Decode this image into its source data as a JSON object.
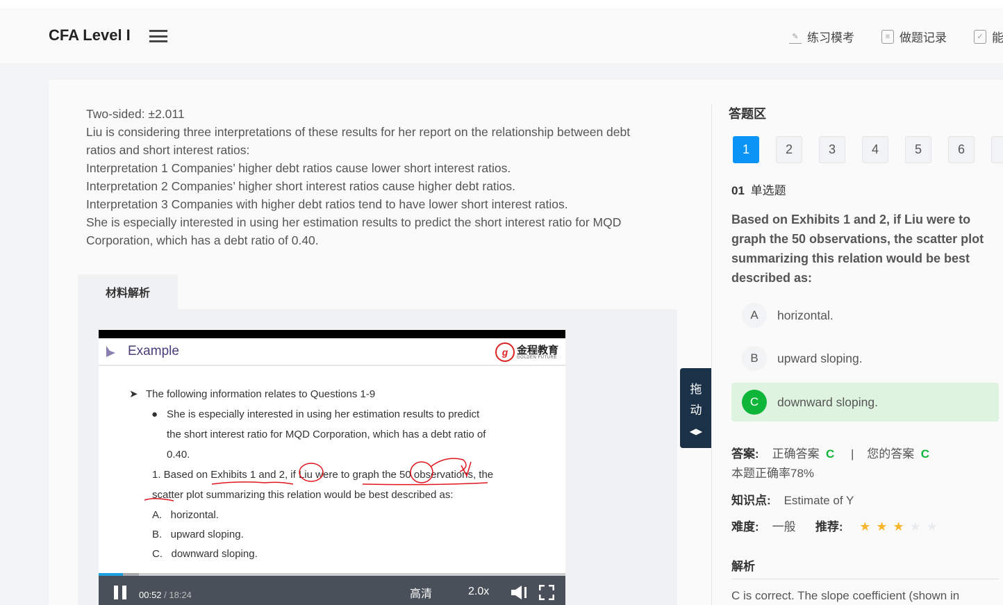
{
  "header": {
    "title": "CFA Level I",
    "nav": [
      {
        "label": "练习模考",
        "icon": "pencil-icon"
      },
      {
        "label": "做题记录",
        "icon": "clipboard-icon"
      },
      {
        "label": "能",
        "icon": "checkbox-icon"
      }
    ]
  },
  "passage": [
    "Two-sided: ±2.011",
    "Liu is considering three interpretations of these results for her report on the relationship between debt ratios and short interest ratios:",
    "Interpretation 1 Companies’ higher debt ratios cause lower short interest ratios.",
    "Interpretation 2 Companies’ higher short interest ratios cause higher debt ratios.",
    "Interpretation 3 Companies with higher debt ratios tend to have lower short interest ratios.",
    "She is especially interested in using her estimation results to predict the short interest ratio for MQD Corporation, which has a debt ratio of 0.40."
  ],
  "material_tab": "材料解析",
  "video": {
    "slide_title": "Example",
    "brand_cn": "金程教育",
    "brand_en": "GOLDEN FUTURE",
    "lines": {
      "intro": "The following information relates to Questions 1-9",
      "bullet1": "She is especially interested in using her estimation results to predict",
      "bullet2": "the short interest ratio for MQD Corporation, which has a debt ratio of",
      "bullet3": "0.40.",
      "q1": "1. Based on Exhibits 1 and 2, if Liu were to graph the 50 observations, the",
      "q2": "scatter plot summarizing this relation would be best described as:",
      "a": "A.   horizontal.",
      "b": "B.   upward sloping.",
      "c": "C.   downward sloping."
    },
    "current_time": "00:52",
    "total_time": " / 18:24",
    "quality": "高清",
    "speed": "2.0x",
    "progress_fraction": 0.052
  },
  "drag_handle": {
    "l1": "拖",
    "l2": "动"
  },
  "answer_area": {
    "title": "答题区",
    "numbers": [
      "1",
      "2",
      "3",
      "4",
      "5",
      "6"
    ],
    "active": "1",
    "qnum": "01",
    "qtype": "单选题",
    "question": "Based on Exhibits 1 and 2, if Liu were to graph the 50 observations, the scatter plot summarizing this relation would be best described as:",
    "options": [
      {
        "letter": "A",
        "text": "horizontal."
      },
      {
        "letter": "B",
        "text": "upward sloping."
      },
      {
        "letter": "C",
        "text": "downward sloping."
      }
    ],
    "answer_label": "答案:",
    "correct_label": "正确答案",
    "correct": "C",
    "sep": "|",
    "your_label": "您的答案",
    "yours": "C",
    "accuracy": "本题正确率78%",
    "kp_label": "知识点:",
    "kp": "Estimate of Y",
    "difficulty_label": "难度:",
    "difficulty": "一般",
    "recommend_label": "推荐:",
    "rating": 3,
    "rating_max": 5,
    "analysis_title": "解析",
    "analysis": "C is correct. The slope coefficient (shown in"
  },
  "colors": {
    "accent": "#0a94f5",
    "correct": "#0db639",
    "star": "#f7b52c",
    "star_empty": "#e8ebf0"
  }
}
